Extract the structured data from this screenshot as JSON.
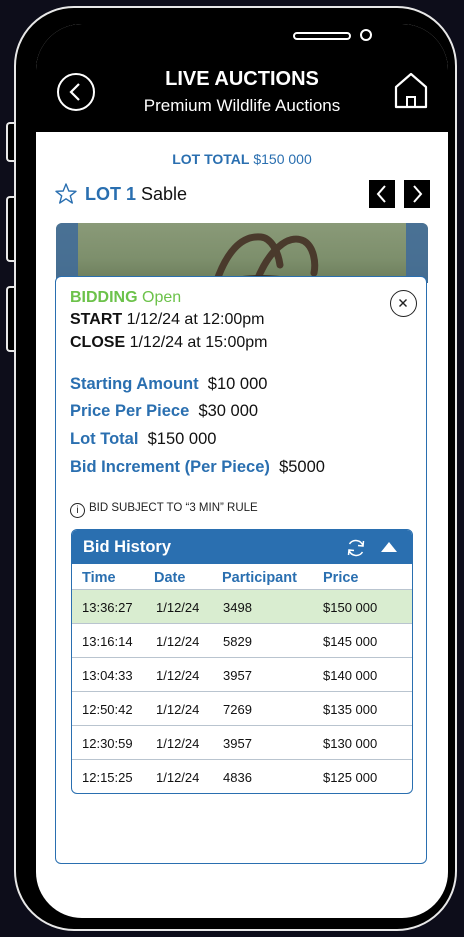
{
  "header": {
    "title": "LIVE AUCTIONS",
    "subtitle": "Premium Wildlife Auctions"
  },
  "lot_total": {
    "label": "LOT TOTAL",
    "value": "$150 000"
  },
  "lot": {
    "number": "LOT 1",
    "name": "Sable"
  },
  "bidding": {
    "status_label": "BIDDING",
    "status_value": "Open",
    "start_label": "START",
    "start_value": "1/12/24 at 12:00pm",
    "close_label": "CLOSE",
    "close_value": "1/12/24 at 15:00pm"
  },
  "details": [
    {
      "label": "Starting Amount",
      "value": "$10 000"
    },
    {
      "label": "Price Per Piece",
      "value": "$30 000"
    },
    {
      "label": "Lot Total",
      "value": "$150 000"
    },
    {
      "label": "Bid Increment (Per Piece)",
      "value": "$5000"
    }
  ],
  "rule_note": "BID SUBJECT TO “3 MIN” RULE",
  "history": {
    "title": "Bid History",
    "columns": [
      "Time",
      "Date",
      "Participant",
      "Price"
    ],
    "rows": [
      {
        "time": "13:36:27",
        "date": "1/12/24",
        "participant": "3498",
        "price": "$150 000"
      },
      {
        "time": "13:16:14",
        "date": "1/12/24",
        "participant": "5829",
        "price": "$145 000"
      },
      {
        "time": "13:04:33",
        "date": "1/12/24",
        "participant": "3957",
        "price": "$140 000"
      },
      {
        "time": "12:50:42",
        "date": "1/12/24",
        "participant": "7269",
        "price": "$135 000"
      },
      {
        "time": "12:30:59",
        "date": "1/12/24",
        "participant": "3957",
        "price": "$130 000"
      },
      {
        "time": "12:15:25",
        "date": "1/12/24",
        "participant": "4836",
        "price": "$125 000"
      }
    ]
  },
  "colors": {
    "accent": "#2a6fb0",
    "open_green": "#6cc24a",
    "highlight_row": "#d9edd0"
  }
}
